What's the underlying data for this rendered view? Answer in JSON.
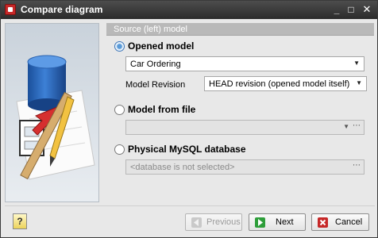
{
  "window": {
    "title": "Compare diagram",
    "controls": {
      "minimize": "_",
      "maximize": "□",
      "close": "✕"
    }
  },
  "section": {
    "header": "Source (left) model"
  },
  "options": {
    "opened_model": {
      "label": "Opened model",
      "selected": true,
      "model_value": "Car Ordering",
      "revision_label": "Model Revision",
      "revision_value": "HEAD revision (opened model itself)"
    },
    "model_from_file": {
      "label": "Model from file",
      "selected": false,
      "file_value": ""
    },
    "mysql_database": {
      "label": "Physical MySQL database",
      "selected": false,
      "database_value": "<database is not selected>"
    }
  },
  "buttons": {
    "help": "?",
    "previous": "Previous",
    "next": "Next",
    "cancel": "Cancel"
  },
  "colors": {
    "titlebar": "#2b2b2b",
    "section_header": "#b9b9b9",
    "next_icon": "#2e9e3a",
    "cancel_icon": "#c62828"
  },
  "icons": {
    "app": "app-icon",
    "help": "help-icon",
    "previous": "arrow-left-icon",
    "next": "arrow-right-icon",
    "cancel": "x-icon"
  }
}
